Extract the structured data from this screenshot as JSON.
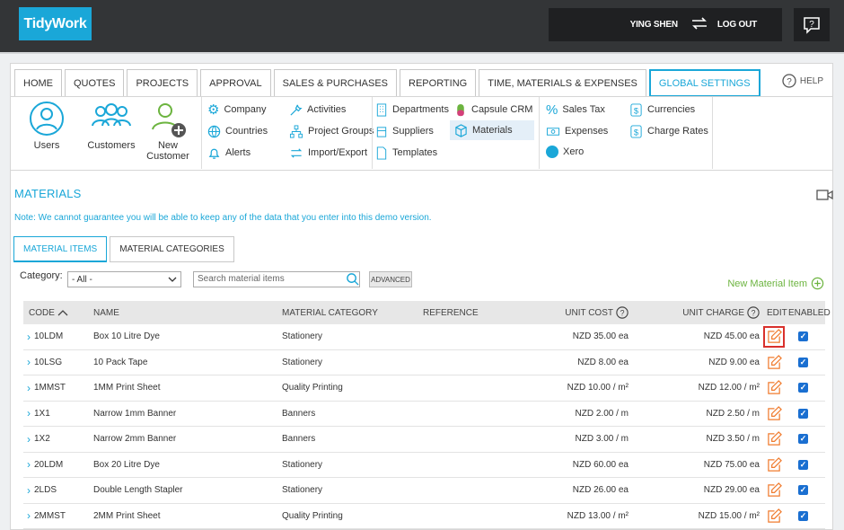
{
  "app": {
    "logo_text": "TidyWork",
    "user": "YING SHEN",
    "logout": "LOG OUT"
  },
  "nav": {
    "tabs": [
      "HOME",
      "QUOTES",
      "PROJECTS",
      "APPROVAL",
      "SALES & PURCHASES",
      "REPORTING",
      "TIME, MATERIALS & EXPENSES",
      "GLOBAL SETTINGS"
    ],
    "help": "HELP"
  },
  "settings": {
    "big": [
      "Users",
      "Customers",
      "New Customer"
    ],
    "col1": [
      "Company",
      "Countries",
      "Alerts"
    ],
    "col2": [
      "Activities",
      "Project Groups",
      "Import/Export"
    ],
    "col3": [
      "Departments",
      "Suppliers",
      "Templates"
    ],
    "col4": [
      "Capsule CRM",
      "Materials"
    ],
    "col5": [
      "Sales Tax",
      "Expenses",
      "Xero"
    ],
    "col6": [
      "Currencies",
      "Charge Rates"
    ]
  },
  "page": {
    "title": "MATERIALS",
    "note": "Note: We cannot guarantee you will be able to keep any of the data that you enter into this demo version.",
    "tabs": [
      "MATERIAL ITEMS",
      "MATERIAL CATEGORIES"
    ],
    "category_label": "Category:",
    "category_value": "- All -",
    "search_placeholder": "Search material items",
    "advanced": "ADVANCED",
    "new_item": "New Material Item"
  },
  "table": {
    "headers": {
      "code": "CODE",
      "name": "NAME",
      "category": "MATERIAL CATEGORY",
      "reference": "REFERENCE",
      "unit_cost": "UNIT COST",
      "unit_charge": "UNIT CHARGE",
      "edit": "EDIT",
      "enabled": "ENABLED"
    },
    "rows": [
      {
        "code": "10LDM",
        "name": "Box 10 Litre Dye",
        "category": "Stationery",
        "reference": "",
        "unit_cost": "NZD 35.00 ea",
        "unit_charge": "NZD 45.00 ea",
        "enabled": true
      },
      {
        "code": "10LSG",
        "name": "10 Pack Tape",
        "category": "Stationery",
        "reference": "",
        "unit_cost": "NZD 8.00 ea",
        "unit_charge": "NZD 9.00 ea",
        "enabled": true
      },
      {
        "code": "1MMST",
        "name": "1MM Print Sheet",
        "category": "Quality Printing",
        "reference": "",
        "unit_cost": "NZD 10.00 / m²",
        "unit_charge": "NZD 12.00 / m²",
        "enabled": true
      },
      {
        "code": "1X1",
        "name": "Narrow 1mm Banner",
        "category": "Banners",
        "reference": "",
        "unit_cost": "NZD 2.00 / m",
        "unit_charge": "NZD 2.50 / m",
        "enabled": true
      },
      {
        "code": "1X2",
        "name": "Narrow 2mm Banner",
        "category": "Banners",
        "reference": "",
        "unit_cost": "NZD 3.00 / m",
        "unit_charge": "NZD 3.50 / m",
        "enabled": true
      },
      {
        "code": "20LDM",
        "name": "Box 20 Litre Dye",
        "category": "Stationery",
        "reference": "",
        "unit_cost": "NZD 60.00 ea",
        "unit_charge": "NZD 75.00 ea",
        "enabled": true
      },
      {
        "code": "2LDS",
        "name": "Double Length Stapler",
        "category": "Stationery",
        "reference": "",
        "unit_cost": "NZD 26.00 ea",
        "unit_charge": "NZD 29.00 ea",
        "enabled": true
      },
      {
        "code": "2MMST",
        "name": "2MM Print Sheet",
        "category": "Quality Printing",
        "reference": "",
        "unit_cost": "NZD 13.00 / m²",
        "unit_charge": "NZD 15.00 / m²",
        "enabled": true
      }
    ]
  },
  "colors": {
    "accent": "#1aa7d8",
    "green": "#6cb43f",
    "edit": "#f07b2e",
    "highlight": "#d9302c"
  }
}
